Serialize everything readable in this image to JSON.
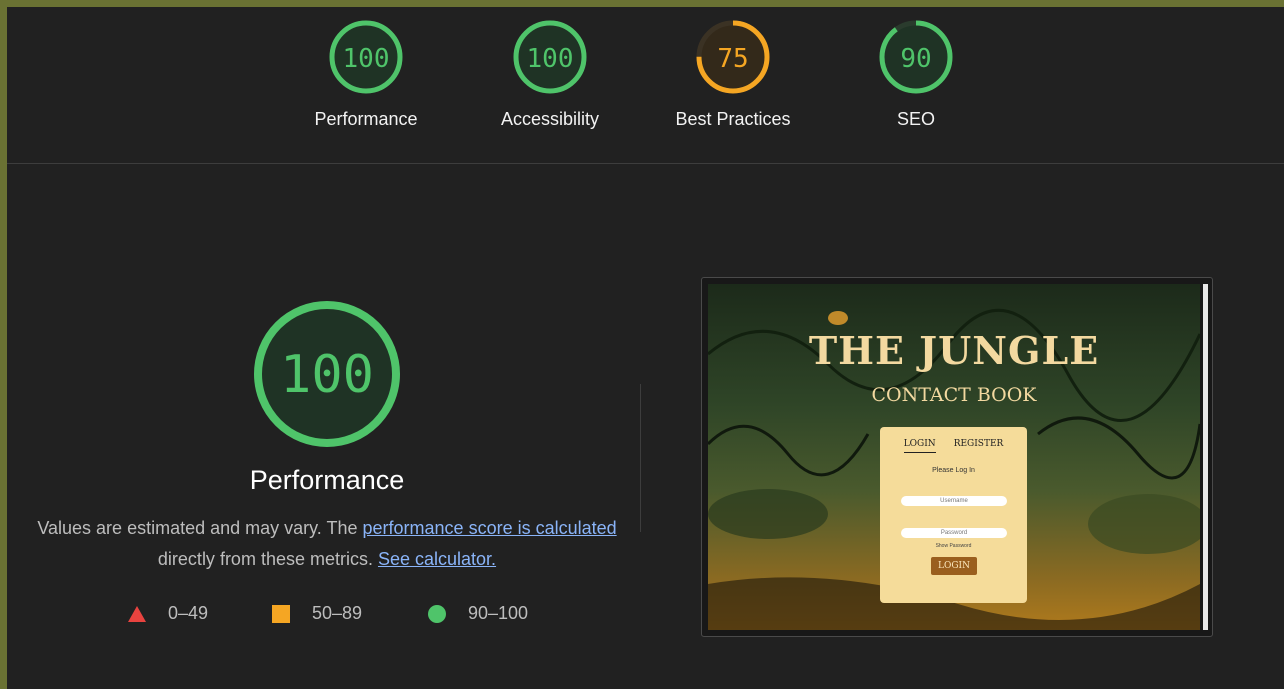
{
  "scores": [
    {
      "value": "100",
      "label": "Performance",
      "score": 100,
      "color": "#4fc46a"
    },
    {
      "value": "100",
      "label": "Accessibility",
      "score": 100,
      "color": "#4fc46a"
    },
    {
      "value": "75",
      "label": "Best Practices",
      "score": 75,
      "color": "#f5a623"
    },
    {
      "value": "90",
      "label": "SEO",
      "score": 90,
      "color": "#4fc46a"
    }
  ],
  "main": {
    "score": "100",
    "title": "Performance",
    "desc_prefix": "Values are estimated and may vary. The ",
    "desc_link1": "performance score is calculated",
    "desc_middle": " directly from these metrics. ",
    "desc_link2": "See calculator."
  },
  "legend": [
    {
      "range": "0–49",
      "shape": "triangle",
      "color": "#e8433f"
    },
    {
      "range": "50–89",
      "shape": "square",
      "color": "#f5a623"
    },
    {
      "range": "90–100",
      "shape": "circle",
      "color": "#4fc46a"
    }
  ],
  "thumbnail": {
    "title": "THE JUNGLE",
    "subtitle": "CONTACT BOOK",
    "tab_login": "LOGIN",
    "tab_register": "REGISTER",
    "prompt": "Please Log In",
    "username_placeholder": "Username",
    "password_placeholder": "Password",
    "show_password": "Show Password",
    "login_button": "LOGIN"
  }
}
